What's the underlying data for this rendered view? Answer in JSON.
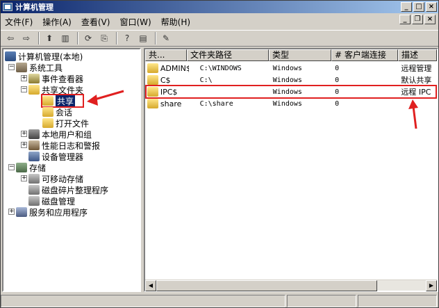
{
  "title": "计算机管理",
  "title_buttons": [
    "_",
    "□",
    "×"
  ],
  "menu": [
    "文件(F)",
    "操作(A)",
    "查看(V)",
    "窗口(W)",
    "帮助(H)"
  ],
  "mdi_buttons": [
    "_",
    "❐",
    "×"
  ],
  "tree": [
    {
      "label": "计算机管理(本地)",
      "icon": "computer-icon"
    },
    {
      "label": "系统工具",
      "icon": "tools-icon"
    },
    {
      "label": "事件查看器",
      "icon": "event-viewer-icon"
    },
    {
      "label": "共享文件夹",
      "icon": "shared-folder-icon"
    },
    {
      "label": "共享",
      "icon": "share-icon"
    },
    {
      "label": "会话",
      "icon": "session-icon"
    },
    {
      "label": "打开文件",
      "icon": "open-files-icon"
    },
    {
      "label": "本地用户和组",
      "icon": "users-icon"
    },
    {
      "label": "性能日志和警报",
      "icon": "perf-log-icon"
    },
    {
      "label": "设备管理器",
      "icon": "device-manager-icon"
    },
    {
      "label": "存储",
      "icon": "storage-icon"
    },
    {
      "label": "可移动存储",
      "icon": "removable-storage-icon"
    },
    {
      "label": "磁盘碎片整理程序",
      "icon": "defrag-icon"
    },
    {
      "label": "磁盘管理",
      "icon": "disk-management-icon"
    },
    {
      "label": "服务和应用程序",
      "icon": "services-icon"
    }
  ],
  "list": {
    "columns": [
      "共...",
      "文件夹路径",
      "类型",
      "# 客户端连接",
      "描述"
    ],
    "rows": [
      {
        "name": "ADMIN$",
        "path": "C:\\WINDOWS",
        "type": "Windows",
        "clients": "0",
        "desc": "远程管理"
      },
      {
        "name": "C$",
        "path": "C:\\",
        "type": "Windows",
        "clients": "0",
        "desc": "默认共享"
      },
      {
        "name": "IPC$",
        "path": "",
        "type": "Windows",
        "clients": "0",
        "desc": "远程 IPC"
      },
      {
        "name": "share",
        "path": "C:\\share",
        "type": "Windows",
        "clients": "0",
        "desc": ""
      }
    ]
  },
  "colors": {
    "title_start": "#0a246a",
    "title_end": "#a6caf0",
    "highlight": "#e02020"
  }
}
